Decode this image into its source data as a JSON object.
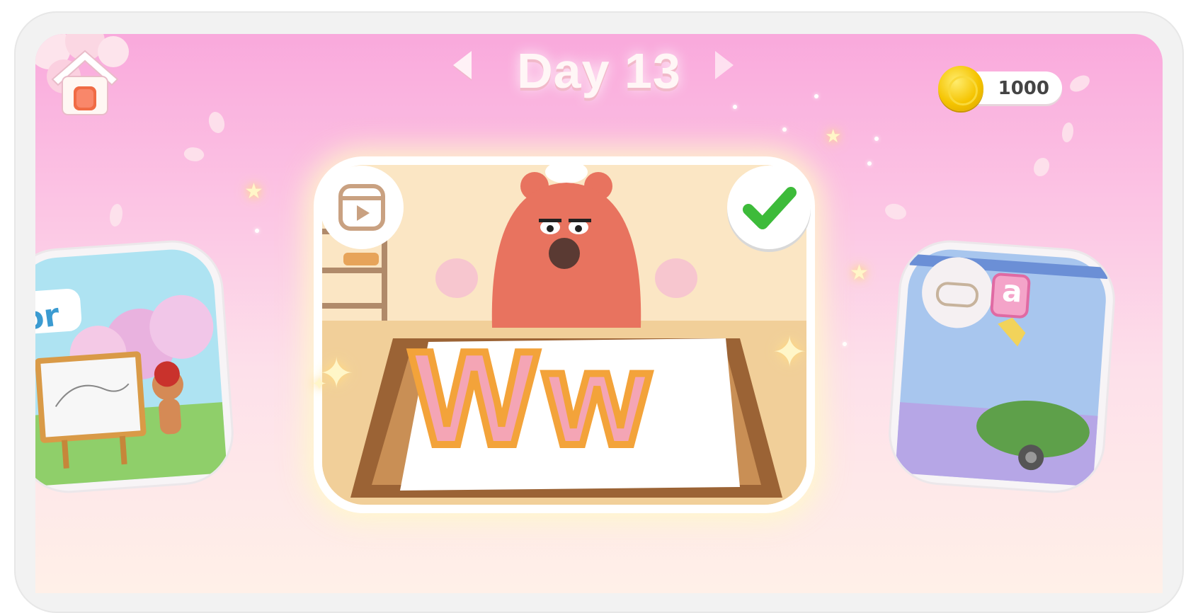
{
  "header": {
    "title": "Day 13",
    "prev_icon": "triangle-left-icon",
    "next_icon": "triangle-right-icon",
    "home_icon": "home-icon"
  },
  "currency": {
    "amount": "1000",
    "icon": "gold-coin-icon"
  },
  "cards": {
    "left": {
      "partial_label": "tor",
      "activity_icon": "coloring"
    },
    "center": {
      "letters": "Ww",
      "status_icon": "checkmark-icon",
      "mode_icon": "video-play-icon",
      "completed": true
    },
    "right": {
      "tile_letter": "a",
      "mode_icon": "gamepad-icon"
    }
  },
  "colors": {
    "bg_top": "#f9a9dc",
    "bg_bottom": "#fff0e8",
    "check_green": "#3dbb3a",
    "bear": "#e8735f"
  }
}
